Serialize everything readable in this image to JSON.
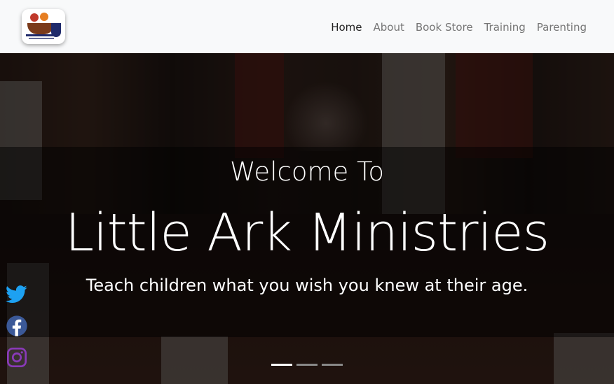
{
  "brand": {
    "logo_alt": "Little Ark Ministries logo",
    "logo_icon": "ark-logo"
  },
  "nav": {
    "items": [
      {
        "label": "Home",
        "active": true
      },
      {
        "label": "About",
        "active": false
      },
      {
        "label": "Book Store",
        "active": false
      },
      {
        "label": "Training",
        "active": false
      },
      {
        "label": "Parenting",
        "active": false
      }
    ]
  },
  "hero": {
    "welcome": "Welcome To",
    "title": "Little Ark Ministries",
    "tagline": "Teach children what you wish you knew at their age.",
    "carousel": {
      "slides": 3,
      "active_index": 0
    }
  },
  "social": [
    {
      "icon": "twitter-icon",
      "color": "#1da1f2"
    },
    {
      "icon": "facebook-icon",
      "color": "#3b5998"
    },
    {
      "icon": "instagram-icon",
      "color": "#8a3ab9"
    }
  ],
  "colors": {
    "nav_bg": "#f8f9fa",
    "nav_text": "#757575",
    "nav_active": "#222222"
  }
}
